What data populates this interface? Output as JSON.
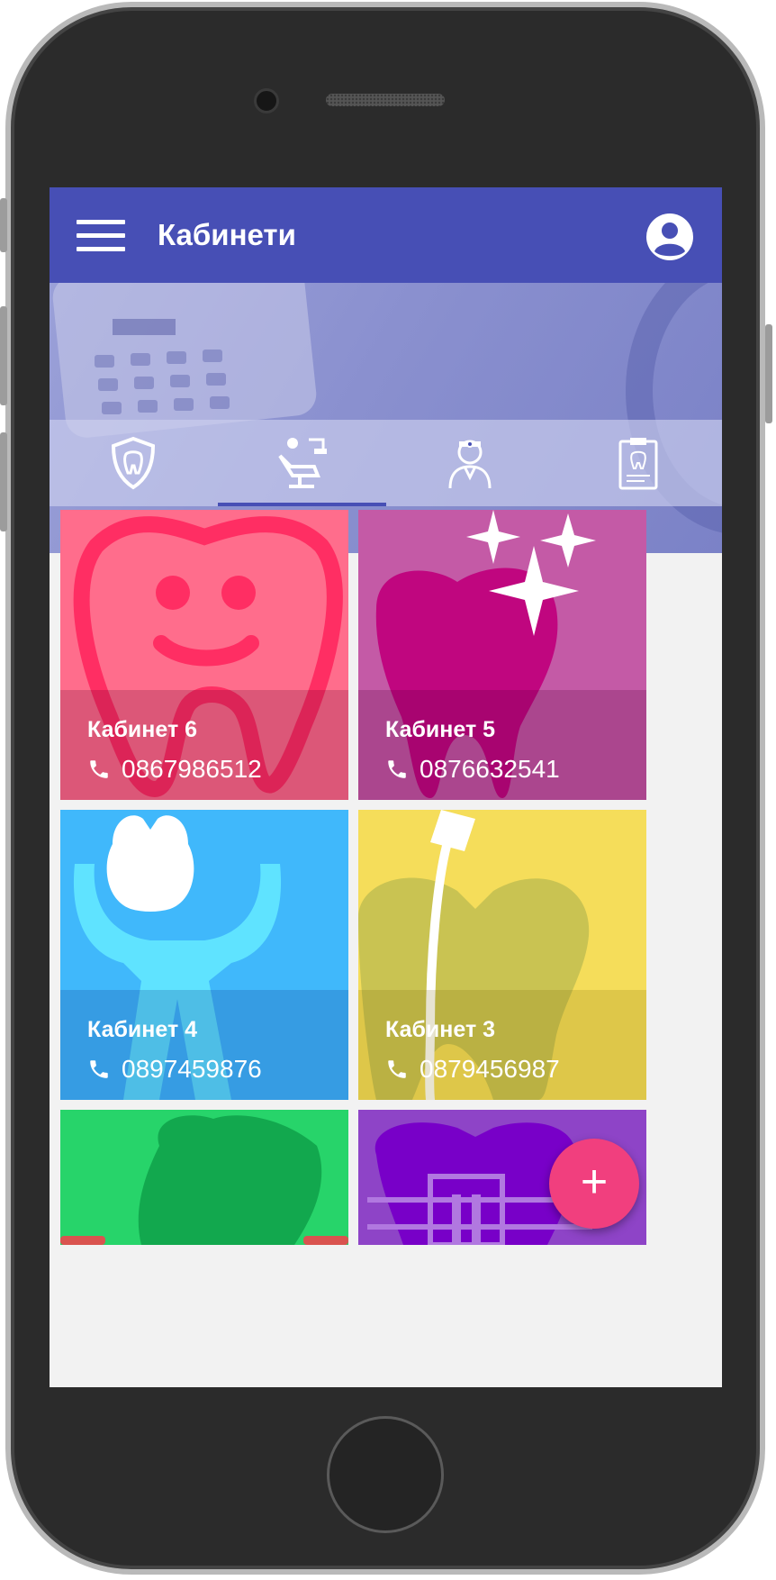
{
  "appbar": {
    "title": "Кабинети",
    "color": "#474fb5"
  },
  "tabs": [
    {
      "icon": "tooth-shield-icon",
      "active": false
    },
    {
      "icon": "dental-chair-icon",
      "active": true
    },
    {
      "icon": "dentist-icon",
      "active": false
    },
    {
      "icon": "dental-clipboard-icon",
      "active": false
    }
  ],
  "cabinets": [
    {
      "name": "Кабинет 6",
      "phone": "0867986512",
      "color": "#ff6d8c",
      "icon": "smiling-tooth-icon"
    },
    {
      "name": "Кабинет 5",
      "phone": "0876632541",
      "color": "#c45aa6",
      "icon": "sparkling-tooth-icon"
    },
    {
      "name": "Кабинет 4",
      "phone": "0897459876",
      "color": "#40b8fb",
      "icon": "tooth-extraction-icon"
    },
    {
      "name": "Кабинет 3",
      "phone": "0879456987",
      "color": "#f5dd5a",
      "icon": "root-canal-tooth-icon"
    },
    {
      "name": "",
      "phone": "",
      "color": "#27d46a",
      "icon": "tooth-icon"
    },
    {
      "name": "",
      "phone": "",
      "color": "#8e44c7",
      "icon": "braces-tooth-icon"
    }
  ],
  "fab": {
    "label": "+",
    "color": "#f13f7e"
  }
}
